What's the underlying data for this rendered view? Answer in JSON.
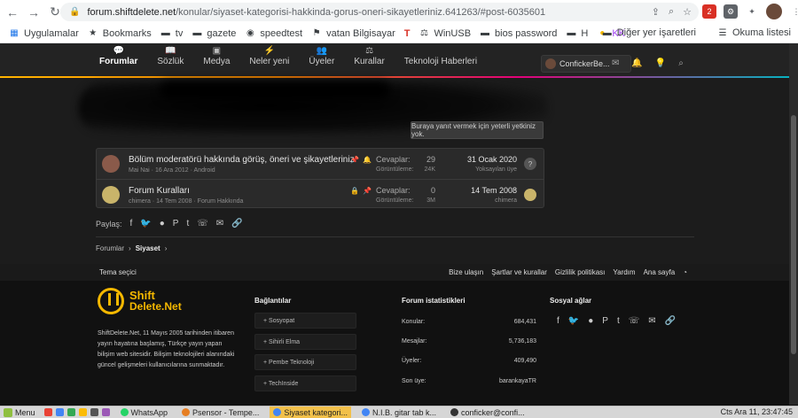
{
  "browser": {
    "url_host": "forum.shiftdelete.net",
    "url_path": "/konular/siyaset-kategorisi-hakkinda-gorus-oneri-sikayetleriniz.641263/#post-6035601",
    "extension_badge": "2"
  },
  "bookmarks": {
    "left": [
      "Uygulamalar",
      "Bookmarks",
      "tv",
      "gazete",
      "speedtest",
      "vatan Bilgisayar",
      "T",
      "WinUSB",
      "bios password",
      "H",
      "KK"
    ],
    "right": [
      "Diğer yer işaretleri",
      "Okuma listesi"
    ]
  },
  "nav": {
    "items": [
      "Forumlar",
      "Sözlük",
      "Medya",
      "Neler yeni",
      "Üyeler",
      "Kurallar",
      "Teknoloji Haberleri"
    ],
    "user": "ConfickerBe..."
  },
  "content": {
    "reply_note": "Buraya yanıt vermek için yeterli yetkiniz yok.",
    "threads": [
      {
        "title": "Bölüm moderatörü hakkında görüş, öneri ve şikayetleriniz",
        "meta": "Mai Nai · 16 Ara 2012 · Android",
        "replies_label": "Cevaplar:",
        "replies": "29",
        "views_label": "Görüntüleme:",
        "views": "24K",
        "last_date": "31 Ocak 2020",
        "last_user": "Yoksayılan üye",
        "last_avatar": "?"
      },
      {
        "title": "Forum Kuralları",
        "meta": "chimera · 14 Tem 2008 · Forum Hakkında",
        "replies_label": "Cevaplar:",
        "replies": "0",
        "views_label": "Görüntüleme:",
        "views": "3M",
        "last_date": "14 Tem 2008",
        "last_user": "chimera"
      }
    ],
    "share_label": "Paylaş:",
    "breadcrumb": [
      "Forumlar",
      "Siyaset"
    ]
  },
  "footer_bar": {
    "theme": "Tema seçici",
    "links": [
      "Bize ulaşın",
      "Şartlar ve kurallar",
      "Gizlilik politikası",
      "Yardım",
      "Ana sayfa"
    ]
  },
  "footer": {
    "logo_line1": "Shift",
    "logo_line2": "Delete.Net",
    "about": "ShiftDelete.Net, 11 Mayıs 2005 tarihinden itibaren yayın hayatına başlamış, Türkçe yayın yapan bilişim web sitesidir. Bilişim teknolojileri alanındaki güncel gelişmeleri kullanıcılarına sunmaktadır.",
    "links_title": "Bağlantılar",
    "links": [
      "+ Sosyopat",
      "+ Sihirli Elma",
      "+ Pembe Teknoloji",
      "+ TechInside"
    ],
    "stats_title": "Forum istatistikleri",
    "stats": [
      {
        "label": "Konular:",
        "value": "684,431"
      },
      {
        "label": "Mesajlar:",
        "value": "5,736,183"
      },
      {
        "label": "Üyeler:",
        "value": "409,490"
      },
      {
        "label": "Son üye:",
        "value": "barankayaTR"
      }
    ],
    "social_title": "Sosyal ağlar"
  },
  "taskbar": {
    "start": "Menu",
    "tasks": [
      "WhatsApp",
      "Psensor - Tempe...",
      "Siyaset kategori...",
      "N.I.B. gitar tab k...",
      "conficker@confi..."
    ],
    "clock": "Cts Ara 11, 23:47:45"
  },
  "colors": {
    "accent": "#f5b800",
    "task_active": "#f2c04a"
  }
}
